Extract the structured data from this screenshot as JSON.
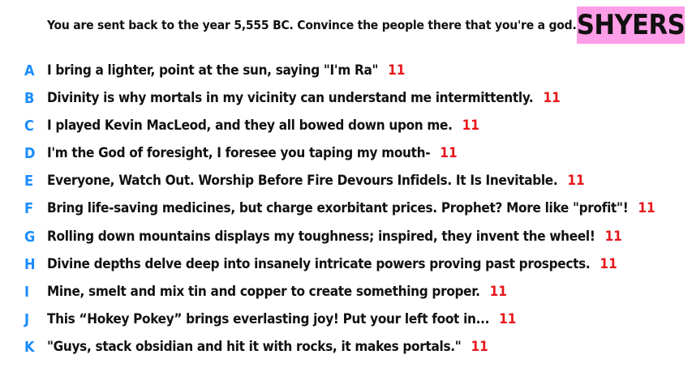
{
  "prompt": "You are sent back to the year 5,555 BC. Convince the people there that you're a god.",
  "badge": {
    "label": "SHYERS",
    "background": "#ff9ee8"
  },
  "colors": {
    "letter": "#1a8cff",
    "score": "#e8161b"
  },
  "answers": [
    {
      "letter": "A",
      "text": "I bring a lighter, point at the sun, saying \"I'm Ra\"",
      "score": "11"
    },
    {
      "letter": "B",
      "text": "Divinity is why mortals in my vicinity can understand me intermittently.",
      "score": "11"
    },
    {
      "letter": "C",
      "text": "I played Kevin MacLeod, and they all bowed down upon me.",
      "score": "11"
    },
    {
      "letter": "D",
      "text": "I'm the God of foresight, I foresee you taping my mouth-",
      "score": "11"
    },
    {
      "letter": "E",
      "text": "Everyone, Watch Out. Worship Before Fire Devours Infidels. It Is Inevitable.",
      "score": "11"
    },
    {
      "letter": "F",
      "text": "Bring life-saving medicines, but charge exorbitant prices. Prophet? More like \"profit\"!",
      "score": "11"
    },
    {
      "letter": "G",
      "text": "Rolling down mountains displays my toughness; inspired, they invent the wheel!",
      "score": "11"
    },
    {
      "letter": "H",
      "text": "Divine depths delve deep into insanely intricate powers proving past prospects.",
      "score": "11"
    },
    {
      "letter": "I",
      "text": "Mine, smelt and mix tin and copper to create something proper.",
      "score": "11"
    },
    {
      "letter": "J",
      "text": "This “Hokey Pokey” brings everlasting joy! Put your left foot in...",
      "score": "11"
    },
    {
      "letter": "K",
      "text": "\"Guys, stack obsidian and hit it with rocks, it makes portals.\"",
      "score": "11"
    }
  ]
}
